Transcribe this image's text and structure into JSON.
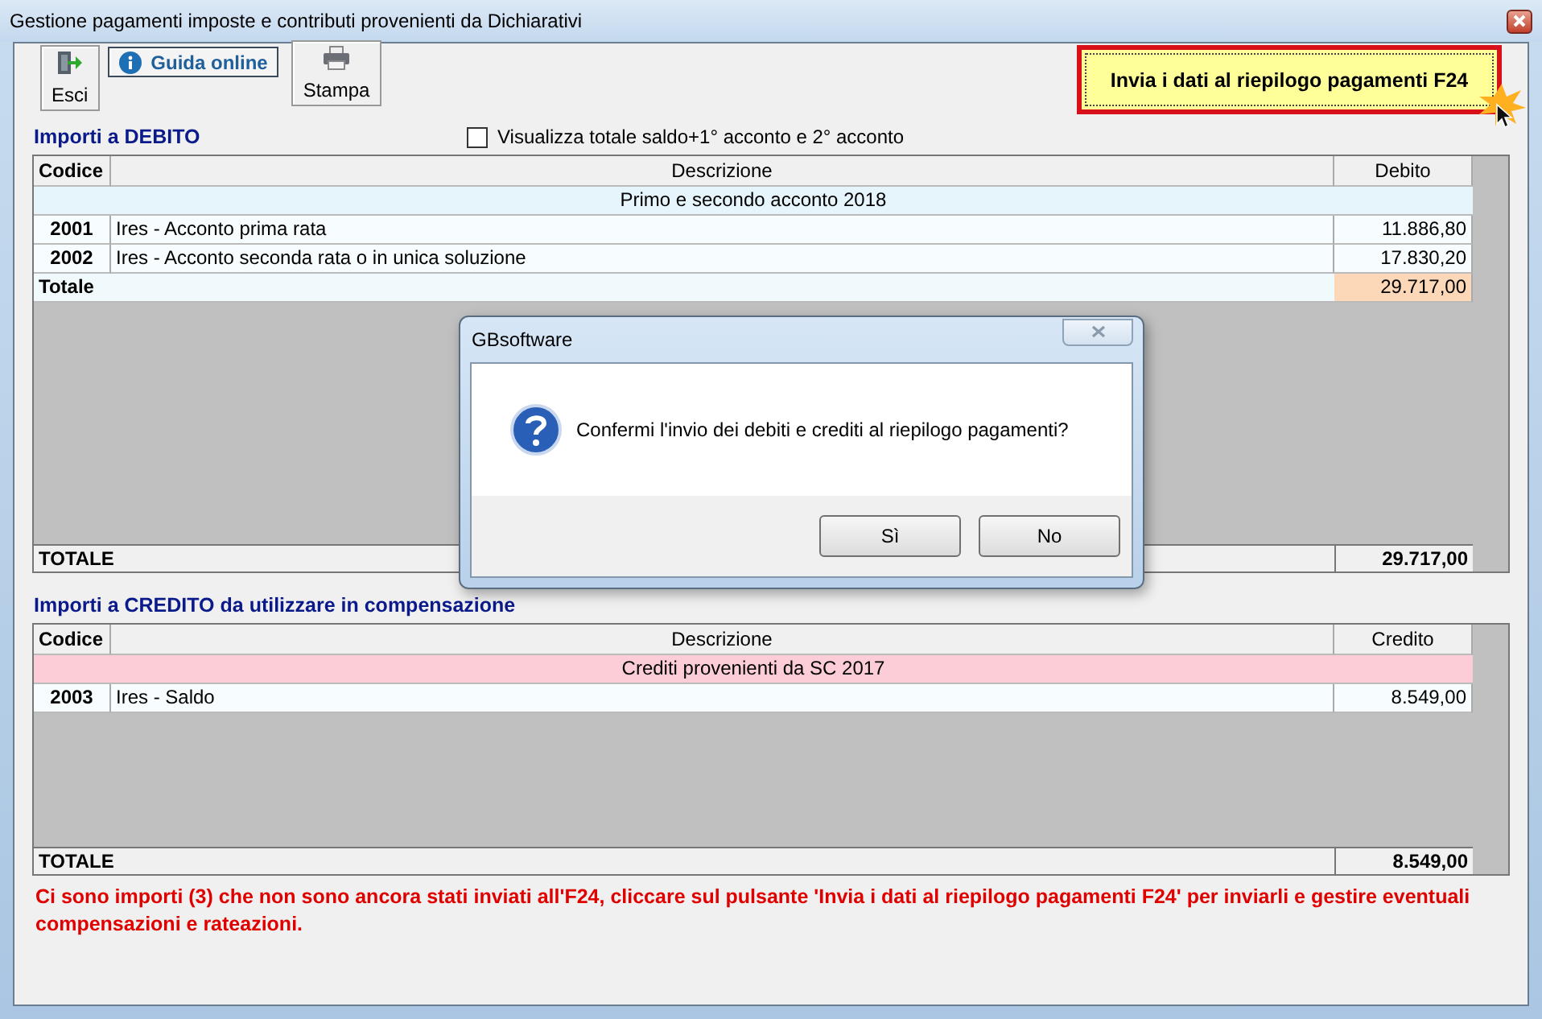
{
  "window": {
    "title": "Gestione pagamenti imposte e contributi provenienti da Dichiarativi"
  },
  "toolbar": [
    {
      "kind": "exit",
      "label": "Esci"
    },
    {
      "kind": "help",
      "label": "Guida online"
    },
    {
      "kind": "print",
      "label": "Stampa"
    }
  ],
  "send_button": {
    "label": "Invia i dati al riepilogo pagamenti F24"
  },
  "sections": [
    {
      "title": "Importi a DEBITO",
      "checkbox": {
        "label": "Visualizza totale saldo+1° acconto e 2° acconto",
        "checked": false
      },
      "columns": [
        "Codice",
        "Descrizione",
        "Debito"
      ],
      "group": "Primo e secondo acconto 2018",
      "color": "#e6f4fc",
      "rows": [
        {
          "code": "2001",
          "description": "Ires - Acconto prima rata",
          "amount": "11.886,80"
        },
        {
          "code": "2002",
          "description": "Ires - Acconto seconda rata o in unica soluzione",
          "amount": "17.830,20"
        }
      ],
      "subtotal": {
        "label": "Totale",
        "value": "29.717,00"
      },
      "total": {
        "label": "TOTALE",
        "value": "29.717,00"
      }
    },
    {
      "title": "Importi a CREDITO da utilizzare in compensazione",
      "columns": [
        "Codice",
        "Descrizione",
        "Credito"
      ],
      "group": "Crediti provenienti da SC 2017",
      "color": "#fccdd7",
      "rows": [
        {
          "code": "2003",
          "description": "Ires - Saldo",
          "amount": "8.549,00"
        }
      ],
      "total": {
        "label": "TOTALE",
        "value": "8.549,00"
      }
    }
  ],
  "message": "Ci sono importi (3) che non sono ancora stati inviati all'F24, cliccare sul pulsante 'Invia i dati al riepilogo pagamenti F24' per inviarli e gestire eventuali compensazioni e rateazioni.",
  "dialog": {
    "title": "GBsoftware",
    "message": "Confermi l'invio dei debiti e crediti al riepilogo pagamenti?",
    "buttons": [
      "Sì",
      "No"
    ]
  }
}
